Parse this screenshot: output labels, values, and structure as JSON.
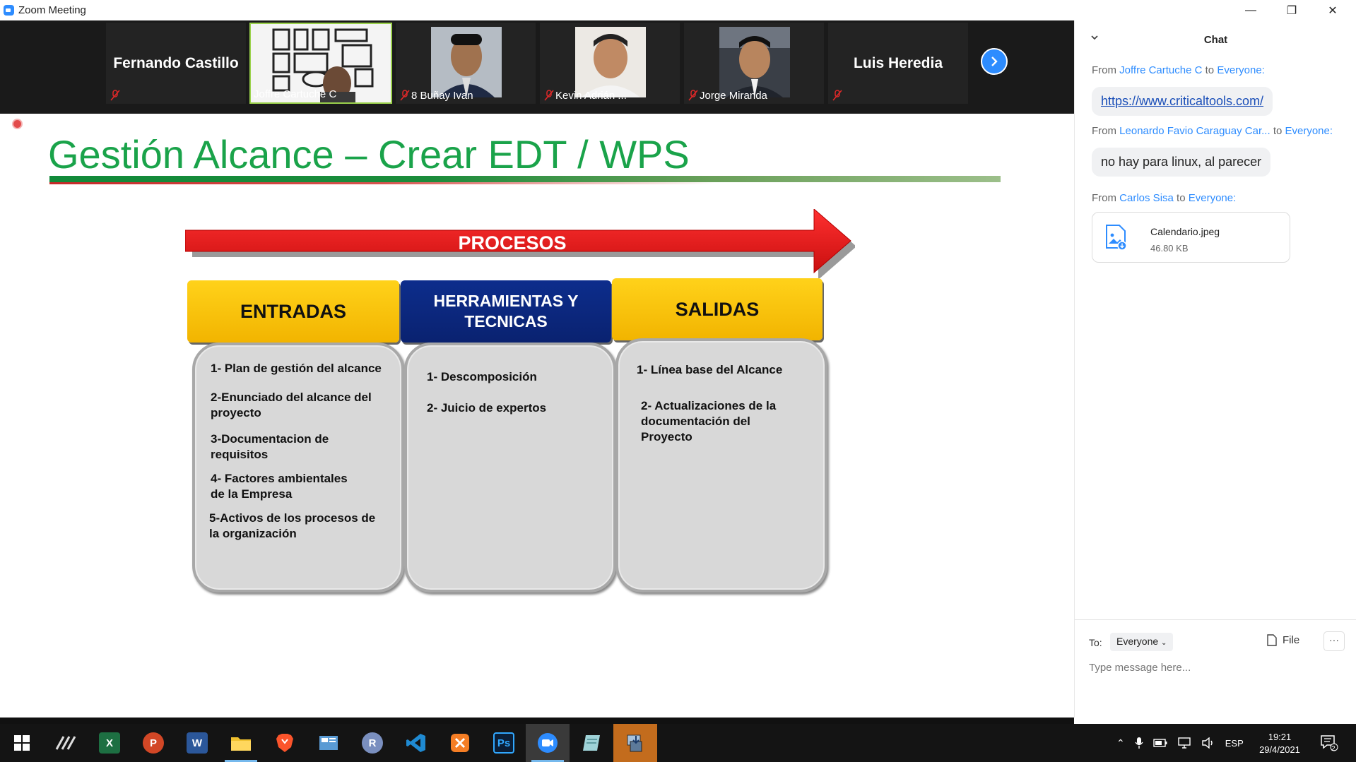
{
  "window": {
    "title": "Zoom Meeting",
    "controls": [
      "—",
      "❐",
      "✕"
    ]
  },
  "gallery": {
    "participants": [
      {
        "name": "Fernando Castillo",
        "video": false,
        "muted": true
      },
      {
        "name": "Joffre Cartuche C",
        "video": true,
        "muted": false,
        "active": true
      },
      {
        "name": "8 Buñay Ivan",
        "video": true,
        "muted": true
      },
      {
        "name": "Kevin Adrián ...",
        "video": true,
        "muted": true
      },
      {
        "name": "Jorge Miranda",
        "video": true,
        "muted": true
      },
      {
        "name": "Luis Heredia",
        "video": false,
        "muted": true
      }
    ]
  },
  "slide": {
    "title": "Gestión Alcance – Crear EDT / WPS",
    "arrow_label": "PROCESOS",
    "columns": [
      {
        "header": "ENTRADAS",
        "items": [
          "1- Plan de gestión del alcance",
          "2-Enunciado del alcance del\nproyecto",
          "3-Documentacion de\n requisitos",
          "4- Factores ambientales\nde la Empresa",
          "5-Activos de los procesos de\n   la organización"
        ]
      },
      {
        "header": "HERRAMIENTAS Y\nTECNICAS",
        "items": [
          "1- Descomposición",
          "2- Juicio de expertos"
        ]
      },
      {
        "header": "SALIDAS",
        "items": [
          "1- Línea base del Alcance",
          "2- Actualizaciones de la\n documentación del\n Proyecto"
        ]
      }
    ],
    "colors": {
      "title": "#1aa34a",
      "arrow": "#e31b1b",
      "yellow": "#f7c500",
      "blue": "#0b2a80",
      "box": "#d8d8d8"
    }
  },
  "chat": {
    "title": "Chat",
    "messages": [
      {
        "from_prefix": "From",
        "sender": "Joffre Cartuche C",
        "to_word": "to",
        "recipient": "Everyone:",
        "text": "https://www.criticaltools.com/"
      },
      {
        "from_prefix": "From",
        "sender": "Leonardo Favio Caraguay Car...",
        "to_word": "to",
        "recipient": "Everyone:",
        "text": "no hay para linux, al parecer"
      },
      {
        "from_prefix": "From",
        "sender": "Carlos Sisa",
        "to_word": "to",
        "recipient": "Everyone:",
        "file": {
          "name": "Calendario.jpeg",
          "size": "46.80 KB"
        }
      }
    ],
    "to_label": "To:",
    "recipient_select": "Everyone",
    "file_button": "File",
    "more_button": "···",
    "input_placeholder": "Type message here..."
  },
  "taskbar": {
    "apps": [
      {
        "name": "Start",
        "icon": "windows-icon"
      },
      {
        "name": "Pen app",
        "icon": "pen-icon"
      },
      {
        "name": "Excel",
        "icon": "excel-icon",
        "letter": "X",
        "color": "#1d6f42"
      },
      {
        "name": "PowerPoint",
        "icon": "powerpoint-icon",
        "letter": "P",
        "color": "#d24726"
      },
      {
        "name": "Word",
        "icon": "word-icon",
        "letter": "W",
        "color": "#2b579a"
      },
      {
        "name": "File Explorer",
        "icon": "folder-icon",
        "color": "#f0c12f"
      },
      {
        "name": "Brave",
        "icon": "brave-icon",
        "color": "#fb542b"
      },
      {
        "name": "Control Panel",
        "icon": "panel-icon",
        "color": "#5a9bd4"
      },
      {
        "name": "R",
        "icon": "r-icon",
        "letter": "R",
        "color": "#7a8fbf"
      },
      {
        "name": "VS Code",
        "icon": "vscode-icon",
        "color": "#1f8ad2"
      },
      {
        "name": "XAMPP",
        "icon": "xampp-icon",
        "color": "#f57e25"
      },
      {
        "name": "Photoshop",
        "icon": "photoshop-icon",
        "letter": "Ps",
        "color": "#0b1e36"
      },
      {
        "name": "Zoom",
        "icon": "zoom-icon",
        "color": "#2D8CFF"
      },
      {
        "name": "Notes",
        "icon": "notes-icon",
        "color": "#9fd3d8"
      },
      {
        "name": "Installer",
        "icon": "installer-icon",
        "color": "#5d7a9a"
      }
    ],
    "tray": {
      "language": "ESP",
      "time": "19:21",
      "date": "29/4/2021",
      "notifications": "2"
    }
  }
}
